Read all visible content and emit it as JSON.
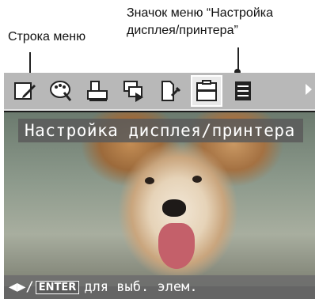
{
  "callouts": {
    "menu_bar_label": "Строка меню",
    "display_printer_icon_label_line1": "Значок меню “Настройка",
    "display_printer_icon_label_line2": "дисплея/принтера”"
  },
  "menubar": {
    "items": [
      {
        "icon": "edit-icon"
      },
      {
        "icon": "palette-icon"
      },
      {
        "icon": "print-document-icon"
      },
      {
        "icon": "slideshow-icon"
      },
      {
        "icon": "file-tools-icon"
      },
      {
        "icon": "display-printer-settings-icon",
        "selected": true
      },
      {
        "icon": "list-settings-icon"
      }
    ],
    "more_arrow": "arrow-right-icon"
  },
  "screen": {
    "title": "Настройка дисплея/принтера",
    "hint": {
      "arrows": "◀▶",
      "slash": "/",
      "enter_key": "ENTER",
      "text": "для выб. элем."
    }
  }
}
